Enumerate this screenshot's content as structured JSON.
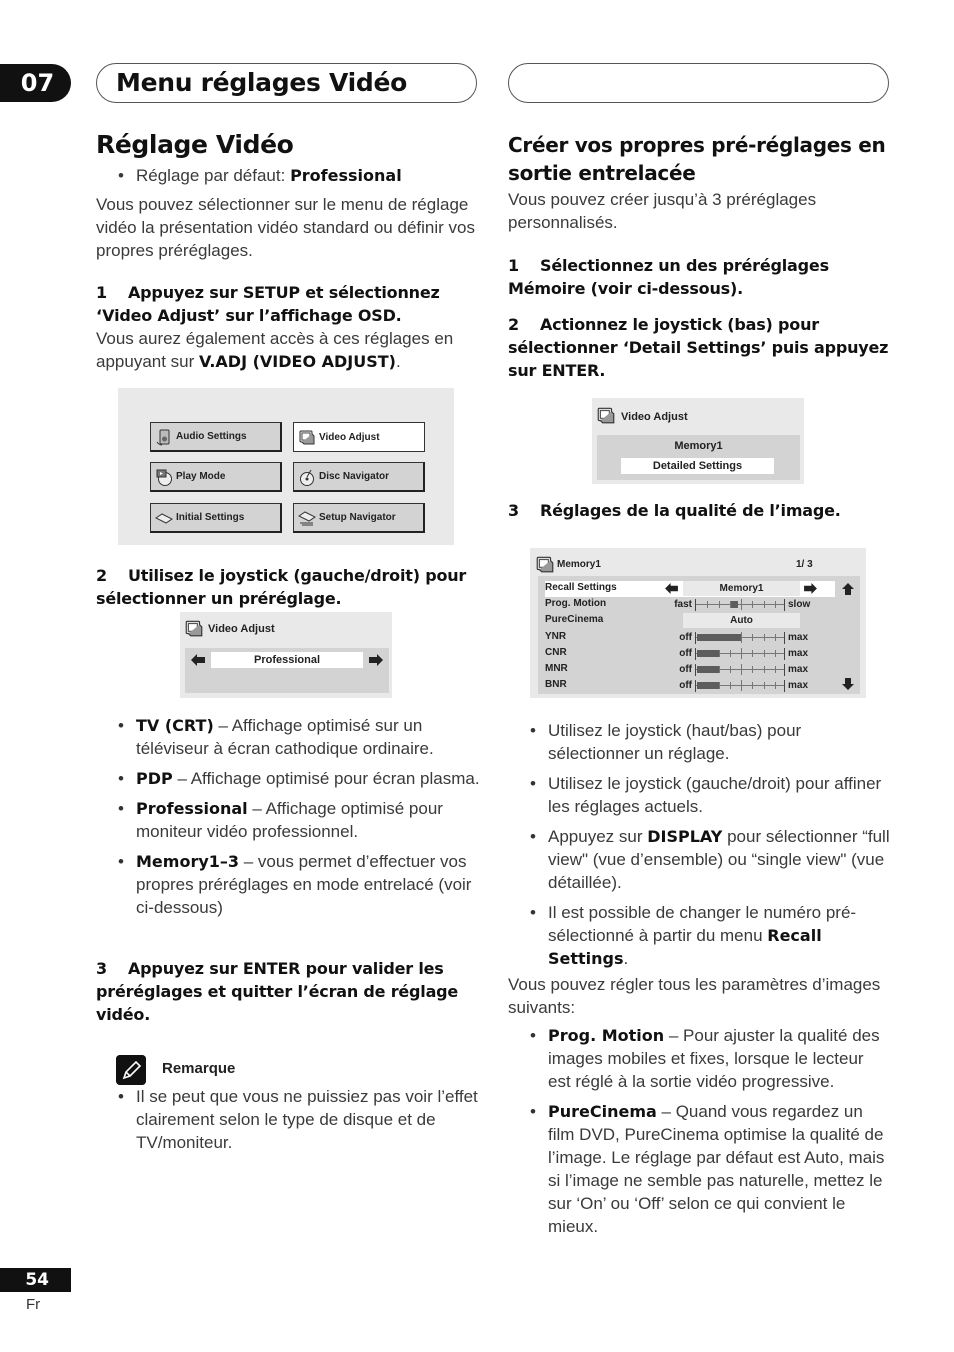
{
  "header": {
    "chapter_number": "07",
    "chapter_title": "Menu réglages Vidéo",
    "right_title": ""
  },
  "left": {
    "title": "Réglage Vidéo",
    "default_label": "Réglage par défaut: ",
    "default_value": "Professional",
    "intro": "Vous pouvez sélectionner sur le menu de réglage vidéo la présentation vidéo standard ou définir vos propres préréglages.",
    "step1": {
      "number": "1",
      "text": "Appuyez sur SETUP et sélectionnez ‘Video Adjust’ sur l’affichage OSD.",
      "body_prefix": "Vous aurez également accès à ces réglages en appuyant sur ",
      "body_bold": "V.ADJ (VIDEO ADJUST)",
      "body_suffix": "."
    },
    "setup_menu": {
      "buttons": [
        {
          "label": "Audio Settings",
          "icon": "speaker-icon",
          "selected": false
        },
        {
          "label": "Video Adjust",
          "icon": "tv-icon",
          "selected": true
        },
        {
          "label": "Play Mode",
          "icon": "play-mode-disc-icon",
          "selected": false
        },
        {
          "label": "Disc Navigator",
          "icon": "disc-navigator-icon",
          "selected": false
        },
        {
          "label": "Initial Settings",
          "icon": "initial-settings-icon",
          "selected": false
        },
        {
          "label": "Setup Navigator",
          "icon": "setup-navigator-icon",
          "selected": false
        }
      ]
    },
    "step2": {
      "number": "2",
      "text": "Utilisez le joystick (gauche/droit) pour sélectionner un préréglage."
    },
    "video_adjust_osd": {
      "title": "Video Adjust",
      "value": "Professional"
    },
    "presets": [
      {
        "term": "TV (CRT)",
        "desc": " – Affichage optimisé sur un téléviseur à écran cathodique ordinaire."
      },
      {
        "term": "PDP",
        "desc": " – Affichage optimisé pour écran plasma."
      },
      {
        "term": "Professional",
        "desc": " – Affichage optimisé pour moniteur vidéo  professionnel."
      },
      {
        "term": "Memory1–3",
        "desc": " – vous permet d’effectuer vos propres préréglages en mode entrelacé (voir ci-dessous)"
      }
    ],
    "step3": {
      "number": "3",
      "text": "Appuyez sur ENTER pour valider les préréglages et quitter l’écran de réglage vidéo."
    },
    "note": {
      "title": "Remarque",
      "items": [
        "Il se peut que vous ne puissiez pas voir l’effet clairement selon le type de disque et de TV/moniteur."
      ]
    }
  },
  "right": {
    "title": "Créer vos propres pré-réglages en sortie entrelacée",
    "intro": "Vous  pouvez créer jusqu’à 3 préréglages personnalisés.",
    "step1": {
      "number": "1",
      "text": "Sélectionnez un des préréglages Mémoire (voir ci-dessous)."
    },
    "step2": {
      "number": "2",
      "text": "Actionnez le joystick (bas) pour sélectionner ‘Detail Settings’ puis appuyez sur ENTER."
    },
    "memory_osd": {
      "title": "Video Adjust",
      "memory": "Memory1",
      "selected": "Detailed Settings"
    },
    "step3": {
      "number": "3",
      "text": "Réglages de la qualité de l’image."
    },
    "detail_osd": {
      "title": "Memory1",
      "page": "1/ 3",
      "rows": [
        {
          "label": "Recall Settings",
          "type": "select",
          "value": "Memory1",
          "selected": true
        },
        {
          "label": "Prog. Motion",
          "type": "slider",
          "min_label": "fast",
          "max_label": "slow",
          "mode": "knob",
          "level": 0.5
        },
        {
          "label": "PureCinema",
          "type": "select",
          "value": "Auto"
        },
        {
          "label": "YNR",
          "type": "slider",
          "min_label": "off",
          "max_label": "max",
          "mode": "fill",
          "level": 0.5
        },
        {
          "label": "CNR",
          "type": "slider",
          "min_label": "off",
          "max_label": "max",
          "mode": "fill",
          "level": 0.25
        },
        {
          "label": "MNR",
          "type": "slider",
          "min_label": "off",
          "max_label": "max",
          "mode": "fill",
          "level": 0.25
        },
        {
          "label": "BNR",
          "type": "slider",
          "min_label": "off",
          "max_label": "max",
          "mode": "fill",
          "level": 0.25
        }
      ]
    },
    "tips": [
      {
        "pre": "Utilisez le joystick (haut/bas) pour sélectionner un réglage.",
        "bold": "",
        "post": ""
      },
      {
        "pre": "Utilisez le joystick (gauche/droit) pour affiner les réglages actuels.",
        "bold": "",
        "post": ""
      },
      {
        "pre": "Appuyez sur ",
        "bold": "DISPLAY",
        "post": " pour sélectionner “full view\" (vue d’ensemble) ou “single view\" (vue détaillée)."
      },
      {
        "pre": "Il est possible de changer le numéro pré-sélectionné à partir du menu ",
        "bold": "Recall Settings",
        "post": "."
      }
    ],
    "params_intro": "Vous pouvez régler tous les paramètres d’images suivants:",
    "params": [
      {
        "term": "Prog. Motion",
        "desc": " – Pour ajuster la qualité des images mobiles et fixes, lorsque le lecteur est réglé à la sortie vidéo progressive."
      },
      {
        "term": "PureCinema",
        "desc": " – Quand vous regardez un film DVD, PureCinema optimise la qualité de l’image. Le réglage par défaut est Auto, mais si l’image ne semble pas naturelle, mettez le sur ‘On’ ou ‘Off’ selon ce qui convient le mieux."
      }
    ]
  },
  "footer": {
    "page_number": "54",
    "language": "Fr"
  }
}
